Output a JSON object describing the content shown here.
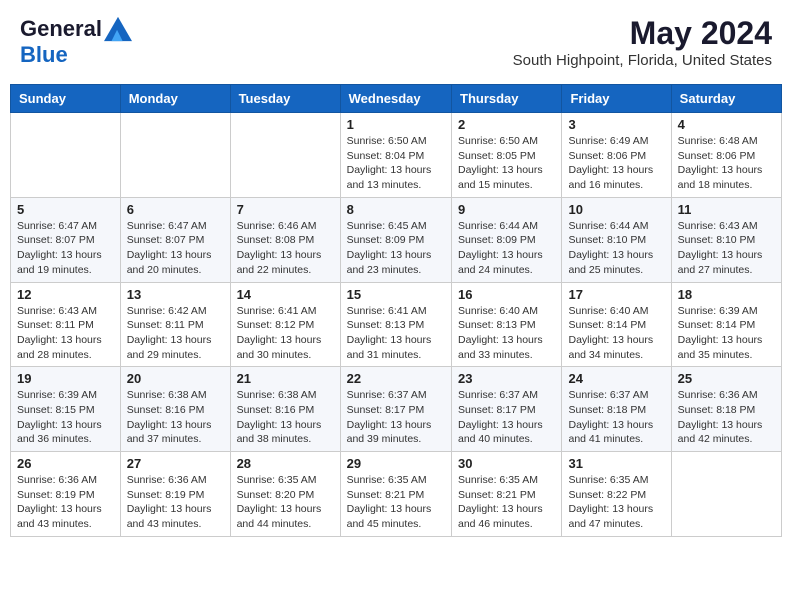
{
  "header": {
    "logo_line1": "General",
    "logo_line2": "Blue",
    "month": "May 2024",
    "location": "South Highpoint, Florida, United States"
  },
  "weekdays": [
    "Sunday",
    "Monday",
    "Tuesday",
    "Wednesday",
    "Thursday",
    "Friday",
    "Saturday"
  ],
  "weeks": [
    [
      {
        "day": "",
        "info": ""
      },
      {
        "day": "",
        "info": ""
      },
      {
        "day": "",
        "info": ""
      },
      {
        "day": "1",
        "info": "Sunrise: 6:50 AM\nSunset: 8:04 PM\nDaylight: 13 hours and 13 minutes."
      },
      {
        "day": "2",
        "info": "Sunrise: 6:50 AM\nSunset: 8:05 PM\nDaylight: 13 hours and 15 minutes."
      },
      {
        "day": "3",
        "info": "Sunrise: 6:49 AM\nSunset: 8:06 PM\nDaylight: 13 hours and 16 minutes."
      },
      {
        "day": "4",
        "info": "Sunrise: 6:48 AM\nSunset: 8:06 PM\nDaylight: 13 hours and 18 minutes."
      }
    ],
    [
      {
        "day": "5",
        "info": "Sunrise: 6:47 AM\nSunset: 8:07 PM\nDaylight: 13 hours and 19 minutes."
      },
      {
        "day": "6",
        "info": "Sunrise: 6:47 AM\nSunset: 8:07 PM\nDaylight: 13 hours and 20 minutes."
      },
      {
        "day": "7",
        "info": "Sunrise: 6:46 AM\nSunset: 8:08 PM\nDaylight: 13 hours and 22 minutes."
      },
      {
        "day": "8",
        "info": "Sunrise: 6:45 AM\nSunset: 8:09 PM\nDaylight: 13 hours and 23 minutes."
      },
      {
        "day": "9",
        "info": "Sunrise: 6:44 AM\nSunset: 8:09 PM\nDaylight: 13 hours and 24 minutes."
      },
      {
        "day": "10",
        "info": "Sunrise: 6:44 AM\nSunset: 8:10 PM\nDaylight: 13 hours and 25 minutes."
      },
      {
        "day": "11",
        "info": "Sunrise: 6:43 AM\nSunset: 8:10 PM\nDaylight: 13 hours and 27 minutes."
      }
    ],
    [
      {
        "day": "12",
        "info": "Sunrise: 6:43 AM\nSunset: 8:11 PM\nDaylight: 13 hours and 28 minutes."
      },
      {
        "day": "13",
        "info": "Sunrise: 6:42 AM\nSunset: 8:11 PM\nDaylight: 13 hours and 29 minutes."
      },
      {
        "day": "14",
        "info": "Sunrise: 6:41 AM\nSunset: 8:12 PM\nDaylight: 13 hours and 30 minutes."
      },
      {
        "day": "15",
        "info": "Sunrise: 6:41 AM\nSunset: 8:13 PM\nDaylight: 13 hours and 31 minutes."
      },
      {
        "day": "16",
        "info": "Sunrise: 6:40 AM\nSunset: 8:13 PM\nDaylight: 13 hours and 33 minutes."
      },
      {
        "day": "17",
        "info": "Sunrise: 6:40 AM\nSunset: 8:14 PM\nDaylight: 13 hours and 34 minutes."
      },
      {
        "day": "18",
        "info": "Sunrise: 6:39 AM\nSunset: 8:14 PM\nDaylight: 13 hours and 35 minutes."
      }
    ],
    [
      {
        "day": "19",
        "info": "Sunrise: 6:39 AM\nSunset: 8:15 PM\nDaylight: 13 hours and 36 minutes."
      },
      {
        "day": "20",
        "info": "Sunrise: 6:38 AM\nSunset: 8:16 PM\nDaylight: 13 hours and 37 minutes."
      },
      {
        "day": "21",
        "info": "Sunrise: 6:38 AM\nSunset: 8:16 PM\nDaylight: 13 hours and 38 minutes."
      },
      {
        "day": "22",
        "info": "Sunrise: 6:37 AM\nSunset: 8:17 PM\nDaylight: 13 hours and 39 minutes."
      },
      {
        "day": "23",
        "info": "Sunrise: 6:37 AM\nSunset: 8:17 PM\nDaylight: 13 hours and 40 minutes."
      },
      {
        "day": "24",
        "info": "Sunrise: 6:37 AM\nSunset: 8:18 PM\nDaylight: 13 hours and 41 minutes."
      },
      {
        "day": "25",
        "info": "Sunrise: 6:36 AM\nSunset: 8:18 PM\nDaylight: 13 hours and 42 minutes."
      }
    ],
    [
      {
        "day": "26",
        "info": "Sunrise: 6:36 AM\nSunset: 8:19 PM\nDaylight: 13 hours and 43 minutes."
      },
      {
        "day": "27",
        "info": "Sunrise: 6:36 AM\nSunset: 8:19 PM\nDaylight: 13 hours and 43 minutes."
      },
      {
        "day": "28",
        "info": "Sunrise: 6:35 AM\nSunset: 8:20 PM\nDaylight: 13 hours and 44 minutes."
      },
      {
        "day": "29",
        "info": "Sunrise: 6:35 AM\nSunset: 8:21 PM\nDaylight: 13 hours and 45 minutes."
      },
      {
        "day": "30",
        "info": "Sunrise: 6:35 AM\nSunset: 8:21 PM\nDaylight: 13 hours and 46 minutes."
      },
      {
        "day": "31",
        "info": "Sunrise: 6:35 AM\nSunset: 8:22 PM\nDaylight: 13 hours and 47 minutes."
      },
      {
        "day": "",
        "info": ""
      }
    ]
  ]
}
